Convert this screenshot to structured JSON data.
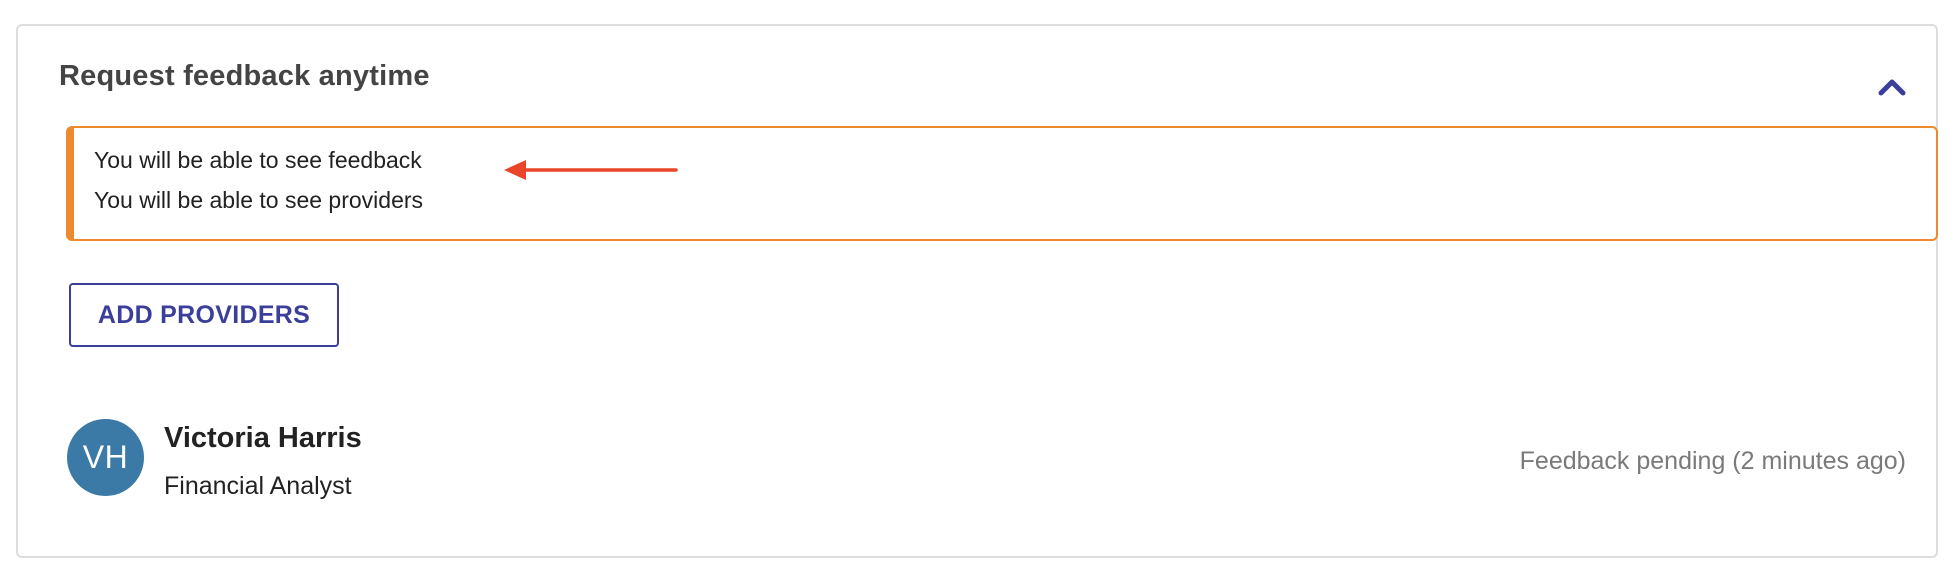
{
  "card": {
    "title": "Request feedback anytime",
    "toggle_icon": "chevron-up-icon"
  },
  "notice": {
    "lines": [
      "You will be able to see feedback",
      "You will be able to see providers"
    ],
    "annotation_icon": "arrow-left-icon"
  },
  "add_providers": {
    "label": "ADD PROVIDERS"
  },
  "providers": [
    {
      "initials": "VH",
      "name": "Victoria Harris",
      "role": "Financial Analyst",
      "status": "Feedback pending (2 minutes ago)"
    }
  ],
  "colors": {
    "accent": "#3b3f9a",
    "notice_border": "#ee8a2e",
    "avatar_bg": "#3b7aa6",
    "annotation_arrow": "#e8452a",
    "status_text": "#7a7a7a"
  }
}
